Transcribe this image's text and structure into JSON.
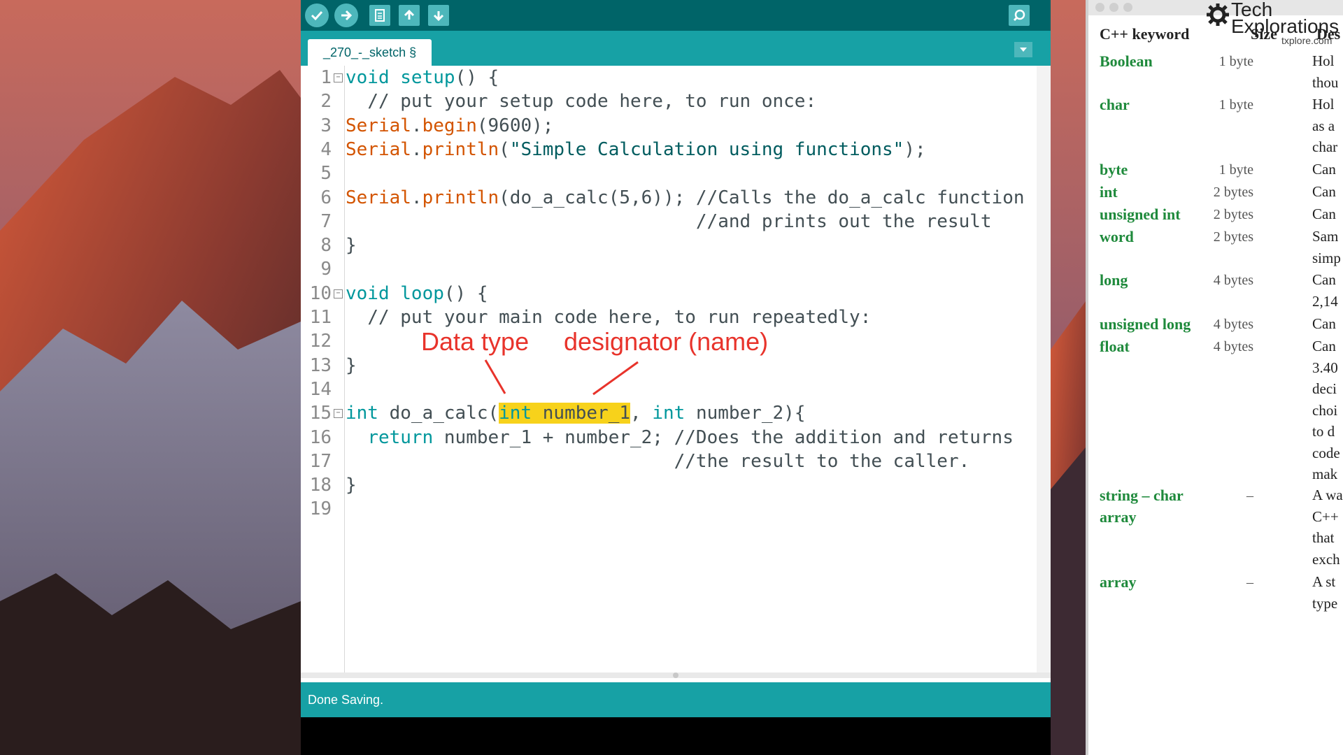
{
  "ide": {
    "tab_label": "_270_-_sketch §",
    "status_text": "Done Saving.",
    "code_lines": [
      {
        "n": "1",
        "html": "<span class=\"kw\">void</span> <span class=\"kw\">setup</span>() {"
      },
      {
        "n": "2",
        "html": "  <span class=\"cmt\">// put your setup code here, to run once:</span>"
      },
      {
        "n": "3",
        "html": "<span class=\"fn\">Serial</span>.<span class=\"fn\">begin</span>(9600);"
      },
      {
        "n": "4",
        "html": "<span class=\"fn\">Serial</span>.<span class=\"fn\">println</span>(<span class=\"strc\">\"Simple Calculation using functions\"</span>);"
      },
      {
        "n": "5",
        "html": ""
      },
      {
        "n": "6",
        "html": "<span class=\"fn\">Serial</span>.<span class=\"fn\">println</span>(do_a_calc(5,6)); <span class=\"cmt\">//Calls the do_a_calc function</span>"
      },
      {
        "n": "7",
        "html": "                                <span class=\"cmt\">//and prints out the result</span>"
      },
      {
        "n": "8",
        "html": "}"
      },
      {
        "n": "9",
        "html": ""
      },
      {
        "n": "10",
        "html": "<span class=\"kw\">void</span> <span class=\"kw\">loop</span>() {"
      },
      {
        "n": "11",
        "html": "  <span class=\"cmt\">// put your main code here, to run repeatedly:</span>"
      },
      {
        "n": "12",
        "html": ""
      },
      {
        "n": "13",
        "html": "}"
      },
      {
        "n": "14",
        "html": ""
      },
      {
        "n": "15",
        "html": "<span class=\"kw\">int</span> do_a_calc(<span class=\"hl\"><span class=\"kw\">int</span> number_1</span>, <span class=\"kw\">int</span> number_2){"
      },
      {
        "n": "16",
        "html": "  <span class=\"kw\">return</span> number_1 + number_2; <span class=\"cmt\">//Does the addition and returns</span>"
      },
      {
        "n": "17",
        "html": "                              <span class=\"cmt\">//the result to the caller.</span>"
      },
      {
        "n": "18",
        "html": "}"
      },
      {
        "n": "19",
        "html": ""
      }
    ],
    "annotation_datatype": "Data type",
    "annotation_designator": "designator (name)"
  },
  "reference": {
    "logo_top": "Tech",
    "logo_bottom": "Explorations",
    "logo_url": "txplore.com",
    "header_keyword": "C++ keyword",
    "header_size": "Size",
    "header_desc": "Des",
    "rows": [
      {
        "keyword": "Boolean",
        "size": "1 byte",
        "desc": [
          "Hol",
          "thou"
        ]
      },
      {
        "keyword": "char",
        "size": "1 byte",
        "desc": [
          "Hol",
          "as a",
          "char"
        ]
      },
      {
        "keyword": "byte",
        "size": "1 byte",
        "desc": [
          "Can"
        ]
      },
      {
        "keyword": "int",
        "size": "2 bytes",
        "desc": [
          "Can"
        ]
      },
      {
        "keyword": "unsigned int",
        "size": "2 bytes",
        "desc": [
          "Can"
        ]
      },
      {
        "keyword": "word",
        "size": "2 bytes",
        "desc": [
          "Sam",
          "simp"
        ]
      },
      {
        "keyword": "long",
        "size": "4 bytes",
        "desc": [
          "Can",
          "2,14"
        ]
      },
      {
        "keyword": "unsigned long",
        "size": "4 bytes",
        "desc": [
          "Can"
        ]
      },
      {
        "keyword": "float",
        "size": "4 bytes",
        "desc": [
          "Can",
          "3.40",
          "deci",
          "choi",
          "to d",
          "code",
          "mak"
        ]
      },
      {
        "keyword": "string – char",
        "size": "–",
        "desc": [
          "A wa",
          "C++",
          "that",
          "exch"
        ]
      },
      {
        "keyword": "array",
        "size": "",
        "desc": []
      },
      {
        "keyword": "array",
        "size": "–",
        "desc": [
          "A st",
          "type"
        ]
      }
    ]
  }
}
